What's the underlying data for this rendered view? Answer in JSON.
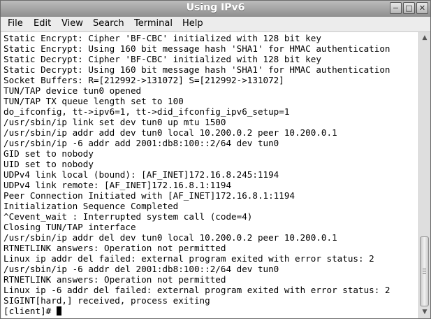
{
  "window": {
    "title": "Using IPv6"
  },
  "controls": {
    "minimize": "−",
    "maximize": "□",
    "close": "✕"
  },
  "menu": [
    {
      "label": "File"
    },
    {
      "label": "Edit"
    },
    {
      "label": "View"
    },
    {
      "label": "Search"
    },
    {
      "label": "Terminal"
    },
    {
      "label": "Help"
    }
  ],
  "terminal": {
    "lines": [
      "Static Encrypt: Cipher 'BF-CBC' initialized with 128 bit key",
      "Static Encrypt: Using 160 bit message hash 'SHA1' for HMAC authentication",
      "Static Decrypt: Cipher 'BF-CBC' initialized with 128 bit key",
      "Static Decrypt: Using 160 bit message hash 'SHA1' for HMAC authentication",
      "Socket Buffers: R=[212992->131072] S=[212992->131072]",
      "TUN/TAP device tun0 opened",
      "TUN/TAP TX queue length set to 100",
      "do_ifconfig, tt->ipv6=1, tt->did_ifconfig_ipv6_setup=1",
      "/usr/sbin/ip link set dev tun0 up mtu 1500",
      "/usr/sbin/ip addr add dev tun0 local 10.200.0.2 peer 10.200.0.1",
      "/usr/sbin/ip -6 addr add 2001:db8:100::2/64 dev tun0",
      "GID set to nobody",
      "UID set to nobody",
      "UDPv4 link local (bound): [AF_INET]172.16.8.245:1194",
      "UDPv4 link remote: [AF_INET]172.16.8.1:1194",
      "Peer Connection Initiated with [AF_INET]172.16.8.1:1194",
      "Initialization Sequence Completed",
      "^Cevent_wait : Interrupted system call (code=4)",
      "Closing TUN/TAP interface",
      "/usr/sbin/ip addr del dev tun0 local 10.200.0.2 peer 10.200.0.1",
      "RTNETLINK answers: Operation not permitted",
      "Linux ip addr del failed: external program exited with error status: 2",
      "/usr/sbin/ip -6 addr del 2001:db8:100::2/64 dev tun0",
      "RTNETLINK answers: Operation not permitted",
      "Linux ip -6 addr del failed: external program exited with error status: 2",
      "SIGINT[hard,] received, process exiting"
    ],
    "prompt": "[client]# "
  },
  "scrollbar": {
    "up_icon": "arrow-up-icon",
    "down_icon": "arrow-down-icon"
  }
}
